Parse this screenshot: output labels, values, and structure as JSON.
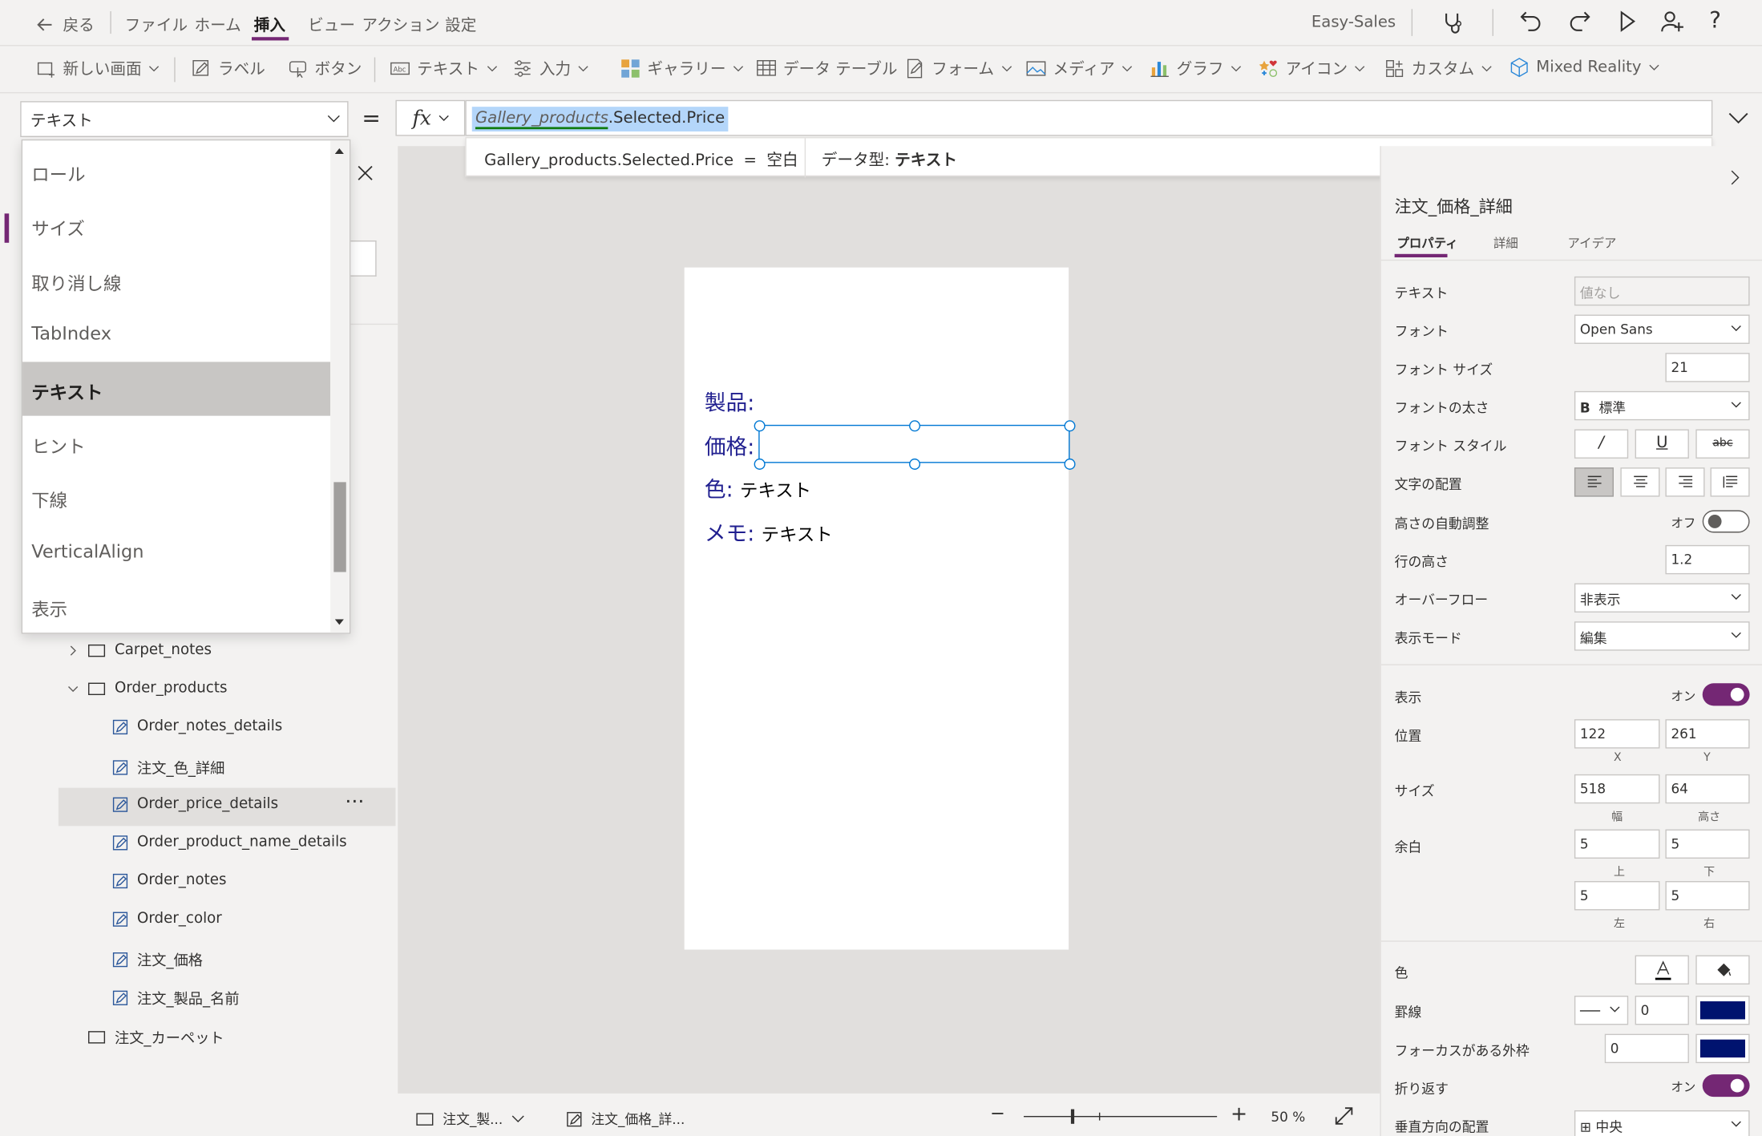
{
  "menubar": {
    "back_label": "戻る",
    "items": [
      "ファイル",
      "ホーム",
      "挿入",
      "ビュー",
      "アクション",
      "設定"
    ],
    "app_name": "Easy-Sales"
  },
  "ribbon": {
    "new_screen": "新しい画面",
    "label": "ラベル",
    "button": "ボタン",
    "text": "テキスト",
    "input": "入力",
    "gallery": "ギャラリー",
    "data_table": "データ テーブル",
    "form": "フォーム",
    "media": "メディア",
    "chart": "グラフ",
    "icon": "アイコン",
    "custom": "カスタム",
    "mixed_reality": "Mixed Reality"
  },
  "formula_bar": {
    "property": "テキスト",
    "equals": "=",
    "fx": "fx",
    "formula_part1": "Gallery_products",
    "formula_part2": ".Selected.Price",
    "hint_expr": "Gallery_products.Selected.Price  =  空白",
    "hint_type_label": "データ型: ",
    "hint_type_value": "テキスト"
  },
  "dropdown": {
    "items": [
      "ロール",
      "サイズ",
      "取り消し線",
      "TabIndex",
      "テキスト",
      "ヒント",
      "下線",
      "VerticalAlign",
      "表示"
    ],
    "selected_index": 4
  },
  "tree": {
    "items": [
      {
        "label": "Carpet_notes",
        "indent": 1,
        "type": "container",
        "chevron": "right"
      },
      {
        "label": "Order_products",
        "indent": 1,
        "type": "container",
        "chevron": "down"
      },
      {
        "label": "Order_notes_details",
        "indent": 2,
        "type": "label"
      },
      {
        "label": "注文_色_詳細",
        "indent": 2,
        "type": "label"
      },
      {
        "label": "Order_price_details",
        "indent": 2,
        "type": "label",
        "selected": true
      },
      {
        "label": "Order_product_name_details",
        "indent": 2,
        "type": "label"
      },
      {
        "label": "Order_notes",
        "indent": 2,
        "type": "label"
      },
      {
        "label": "Order_color",
        "indent": 2,
        "type": "label"
      },
      {
        "label": "注文_価格",
        "indent": 2,
        "type": "label"
      },
      {
        "label": "注文_製品_名前",
        "indent": 2,
        "type": "label"
      },
      {
        "label": "注文_カーペット",
        "indent": 1,
        "type": "container"
      }
    ],
    "more": "···"
  },
  "canvas": {
    "product_label": "製品:",
    "price_label": "価格:",
    "color_label": "色:",
    "color_value": "テキスト",
    "memo_label": "メモ:",
    "memo_value": "テキスト"
  },
  "bottombar": {
    "screen_tab": "注文_製...",
    "control_tab": "注文_価格_詳...",
    "zoom_minus": "−",
    "zoom_plus": "+",
    "zoom_value": "50",
    "zoom_unit": "%"
  },
  "props": {
    "control_name": "注文_価格_詳細",
    "tabs": [
      "プロパティ",
      "詳細",
      "アイデア"
    ],
    "text_label": "テキスト",
    "text_placeholder": "値なし",
    "font_label": "フォント",
    "font_value": "Open Sans",
    "font_size_label": "フォント サイズ",
    "font_size_value": "21",
    "font_weight_label": "フォントの太さ",
    "font_weight_value": "標準",
    "font_weight_glyph": "B",
    "font_style_label": "フォント スタイル",
    "align_label": "文字の配置",
    "autoheight_label": "高さの自動調整",
    "autoheight_value": "オフ",
    "line_height_label": "行の高さ",
    "line_height_value": "1.2",
    "overflow_label": "オーバーフロー",
    "overflow_value": "非表示",
    "display_mode_label": "表示モード",
    "display_mode_value": "編集",
    "visible_label": "表示",
    "visible_value": "オン",
    "position_label": "位置",
    "x_value": "122",
    "y_value": "261",
    "x_caption": "X",
    "y_caption": "Y",
    "size_label": "サイズ",
    "width_value": "518",
    "height_value": "64",
    "width_caption": "幅",
    "height_caption": "高さ",
    "padding_label": "余白",
    "pad_top": "5",
    "pad_bottom": "5",
    "pad_left": "5",
    "pad_right": "5",
    "top_caption": "上",
    "bottom_caption": "下",
    "left_caption": "左",
    "right_caption": "右",
    "color_label": "色",
    "border_label": "罫線",
    "border_value": "0",
    "focus_border_label": "フォーカスがある外枠",
    "focus_border_value": "0",
    "wrap_label": "折り返す",
    "wrap_value": "オン",
    "valign_label": "垂直方向の配置",
    "valign_value": "中央"
  },
  "colors": {
    "accent": "#742774",
    "selection_blue": "#0078d4",
    "canvas_text": "#201f8f",
    "border_swatch": "#00136f"
  }
}
